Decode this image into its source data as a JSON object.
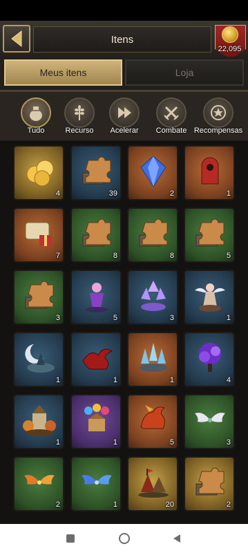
{
  "header": {
    "title": "Itens",
    "back_icon": "chevron-left-icon"
  },
  "gold": {
    "amount": "22,095",
    "icon": "gold-coin-icon"
  },
  "tabs": [
    {
      "label": "Meus itens",
      "active": true
    },
    {
      "label": "Loja",
      "active": false
    }
  ],
  "categories": [
    {
      "label": "Tudo",
      "icon": "sack-icon",
      "active": true
    },
    {
      "label": "Recurso",
      "icon": "wheat-icon",
      "active": false
    },
    {
      "label": "Acelerar",
      "icon": "fast-forward-icon",
      "active": false
    },
    {
      "label": "Combate",
      "icon": "crossed-swords-icon",
      "active": false
    },
    {
      "label": "Recompensas",
      "icon": "star-medal-icon",
      "active": false
    }
  ],
  "items": [
    {
      "name": "gold-coins",
      "qty": "4",
      "bg": "gold"
    },
    {
      "name": "puzzle-chest",
      "qty": "39",
      "bg": "blue"
    },
    {
      "name": "blue-gem",
      "qty": "2",
      "bg": "orange"
    },
    {
      "name": "hooded-figure",
      "qty": "1",
      "bg": "orange"
    },
    {
      "name": "scroll-gift",
      "qty": "7",
      "bg": "orange"
    },
    {
      "name": "puzzle-chest",
      "qty": "8",
      "bg": "green"
    },
    {
      "name": "puzzle-chest",
      "qty": "8",
      "bg": "green"
    },
    {
      "name": "puzzle-chest",
      "qty": "5",
      "bg": "green"
    },
    {
      "name": "puzzle-chest",
      "qty": "3",
      "bg": "green"
    },
    {
      "name": "fairy-statue",
      "qty": "5",
      "bg": "blue"
    },
    {
      "name": "crystal-tree",
      "qty": "3",
      "bg": "blue"
    },
    {
      "name": "angel-statue",
      "qty": "1",
      "bg": "blue"
    },
    {
      "name": "moon-island",
      "qty": "1",
      "bg": "blue"
    },
    {
      "name": "red-dragon",
      "qty": "1",
      "bg": "blue"
    },
    {
      "name": "ice-crystals",
      "qty": "1",
      "bg": "orange"
    },
    {
      "name": "purple-tree",
      "qty": "4",
      "bg": "blue"
    },
    {
      "name": "autumn-castle",
      "qty": "1",
      "bg": "blue"
    },
    {
      "name": "balloon-party",
      "qty": "1",
      "bg": "purple"
    },
    {
      "name": "fire-dragon",
      "qty": "5",
      "bg": "orange"
    },
    {
      "name": "silver-wings",
      "qty": "3",
      "bg": "green"
    },
    {
      "name": "flame-wings",
      "qty": "2",
      "bg": "green"
    },
    {
      "name": "blue-wings",
      "qty": "1",
      "bg": "green"
    },
    {
      "name": "war-camp",
      "qty": "20",
      "bg": "gold"
    },
    {
      "name": "puzzle-chest",
      "qty": "2",
      "bg": "gold"
    }
  ],
  "colors": {
    "accent": "#cfb47b",
    "frame": "#b79c5a",
    "quantity_text": "#ffffff"
  }
}
